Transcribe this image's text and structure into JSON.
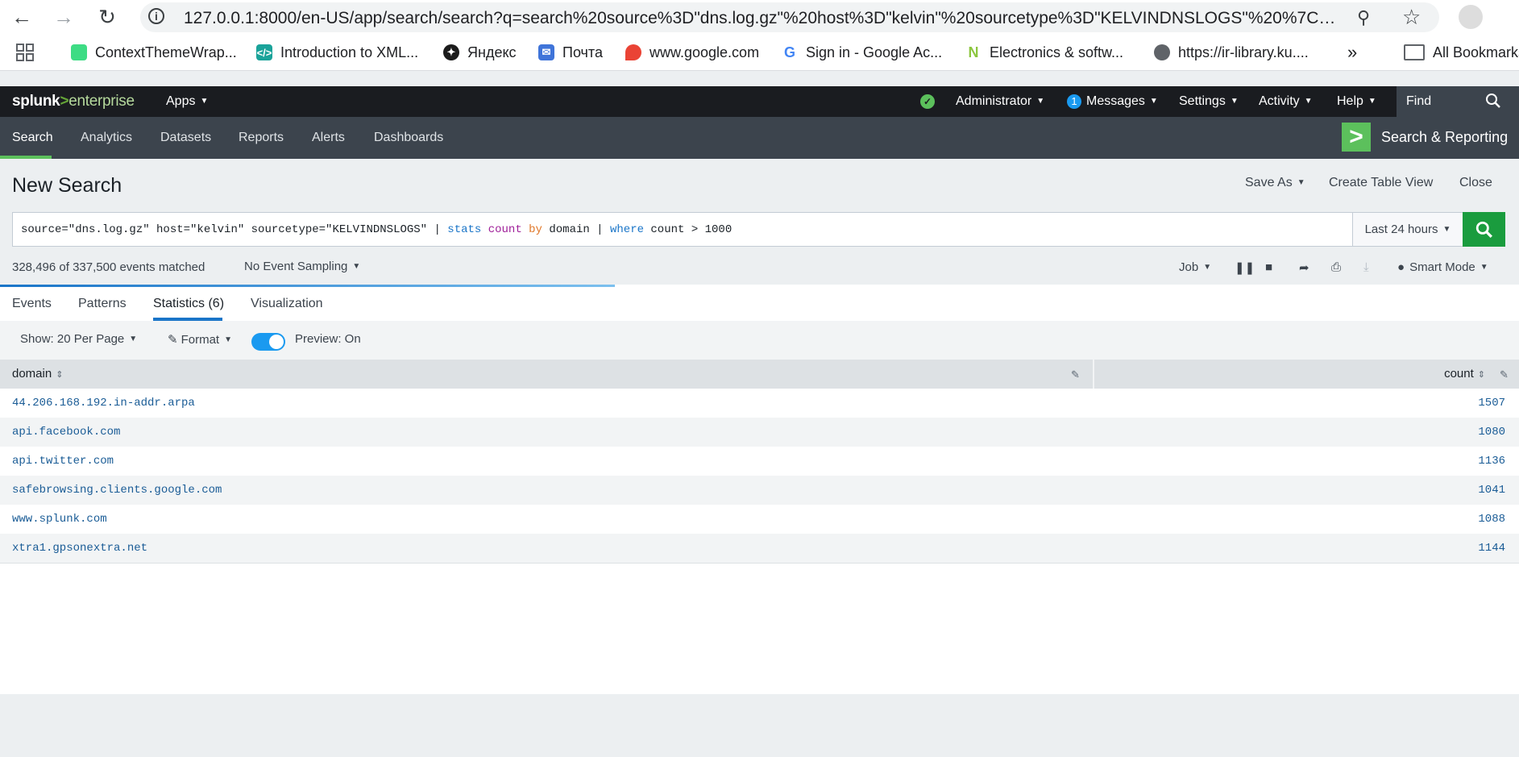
{
  "browser": {
    "url": "127.0.0.1:8000/en-US/app/search/search?q=search%20source%3D\"dns.log.gz\"%20host%3D\"kelvin\"%20sourcetype%3D\"KELVINDNSLOGS\"%20%7C%20sta...",
    "bookmarks": [
      {
        "label": "ContextThemeWrap...",
        "icon": "android-icon"
      },
      {
        "label": "Introduction to XML...",
        "icon": "xml-icon"
      },
      {
        "label": "Яндекс",
        "icon": "yandex-icon"
      },
      {
        "label": "Почта",
        "icon": "mail-icon"
      },
      {
        "label": "www.google.com",
        "icon": "maps-pin-icon"
      },
      {
        "label": "Sign in - Google Ac...",
        "icon": "google-icon"
      },
      {
        "label": "Electronics & softw...",
        "icon": "leaf-icon"
      },
      {
        "label": "https://ir-library.ku....",
        "icon": "globe-icon"
      }
    ],
    "more_label": "»",
    "all_bookmarks": "All Bookmarks"
  },
  "splunk_bar": {
    "logo_splunk": "splunk",
    "logo_gt": ">",
    "logo_enterprise": "enterprise",
    "apps": "Apps",
    "administrator": "Administrator",
    "messages_count": "1",
    "messages": "Messages",
    "settings": "Settings",
    "activity": "Activity",
    "help": "Help",
    "find": "Find"
  },
  "app_bar": {
    "tabs": [
      "Search",
      "Analytics",
      "Datasets",
      "Reports",
      "Alerts",
      "Dashboards"
    ],
    "app_name": "Search & Reporting"
  },
  "search": {
    "title": "New Search",
    "save_as": "Save As",
    "create_table_view": "Create Table View",
    "close": "Close",
    "query_base": "source=\"dns.log.gz\" host=\"kelvin\" sourcetype=\"KELVINDNSLOGS\" | ",
    "query_stats": "stats",
    "query_count": "count",
    "query_by": "by",
    "query_domain": "domain | ",
    "query_where": "where",
    "query_tail": "count > 1000",
    "time_range": "Last 24 hours",
    "events_matched": "328,496 of 337,500 events matched",
    "sampling": "No Event Sampling",
    "job": "Job",
    "smart_mode": "Smart Mode",
    "progress": 0.405
  },
  "results_tabs": [
    "Events",
    "Patterns",
    "Statistics (6)",
    "Visualization"
  ],
  "table_controls": {
    "show": "Show: 20 Per Page",
    "format": "Format",
    "preview": "Preview: On"
  },
  "table": {
    "columns": [
      "domain",
      "count"
    ],
    "rows": [
      {
        "domain": "44.206.168.192.in-addr.arpa",
        "count": "1507"
      },
      {
        "domain": "api.facebook.com",
        "count": "1080"
      },
      {
        "domain": "api.twitter.com",
        "count": "1136"
      },
      {
        "domain": "safebrowsing.clients.google.com",
        "count": "1041"
      },
      {
        "domain": "www.splunk.com",
        "count": "1088"
      },
      {
        "domain": "xtra1.gpsonextra.net",
        "count": "1144"
      }
    ]
  }
}
